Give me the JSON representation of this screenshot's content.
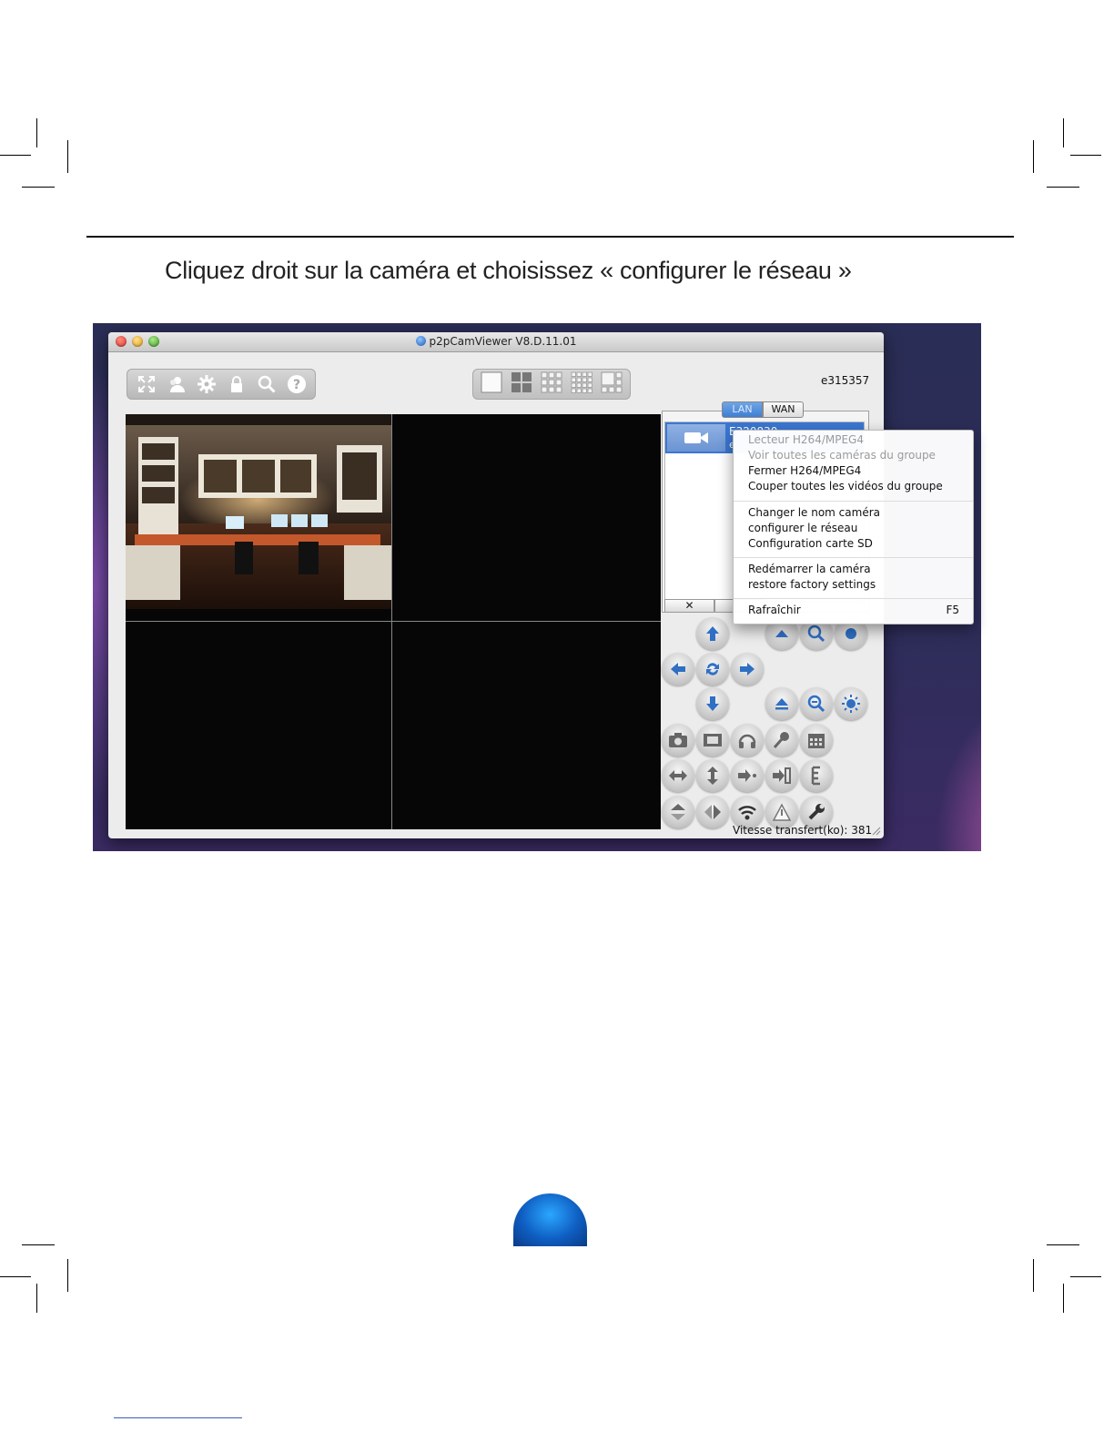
{
  "instruction": "Cliquez droit sur la caméra et choisissez « configurer le réseau »",
  "window": {
    "title": "p2pCamViewer V8.D.11.01",
    "device_id": "e315357",
    "toolbar_icons": [
      "fullscreen-icon",
      "users-icon",
      "gear-icon",
      "lock-icon",
      "search-icon",
      "help-icon"
    ],
    "layout_icons": [
      "layout-1-icon",
      "layout-4-icon",
      "layout-9-icon",
      "layout-16-icon",
      "layout-custom-icon"
    ]
  },
  "network_tabs": {
    "lan": "LAN",
    "wan": "WAN"
  },
  "camera_list": {
    "items": [
      {
        "name": "E320830",
        "sub": "e"
      }
    ],
    "delete_button": "✕"
  },
  "context_menu": {
    "groups": [
      [
        {
          "label": "Lecteur H264/MPEG4",
          "enabled": false
        },
        {
          "label": "Voir toutes les caméras du groupe",
          "enabled": false
        },
        {
          "label": "Fermer H264/MPEG4",
          "enabled": true
        },
        {
          "label": "Couper toutes les vidéos du groupe",
          "enabled": true
        }
      ],
      [
        {
          "label": "Changer le nom caméra",
          "enabled": true
        },
        {
          "label": "configurer le réseau",
          "enabled": true
        },
        {
          "label": "Configuration carte SD",
          "enabled": true
        }
      ],
      [
        {
          "label": "Redémarrer la caméra",
          "enabled": true
        },
        {
          "label": "restore factory settings",
          "enabled": true
        }
      ],
      [
        {
          "label": "Rafraîchir",
          "enabled": true,
          "shortcut": "F5"
        }
      ]
    ]
  },
  "status": {
    "transfer_speed": "Vitesse transfert(ko): 381"
  },
  "colors": {
    "selection_blue": "#3a77d3",
    "page_dot": "#0f5ec2"
  }
}
